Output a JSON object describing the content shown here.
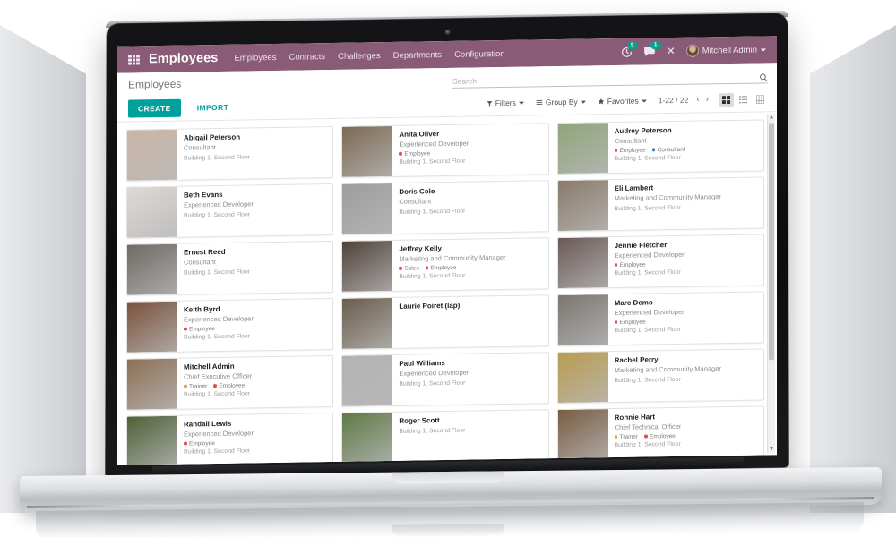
{
  "navbar": {
    "apps_icon": "apps-grid-icon",
    "brand": "Employees",
    "menu": [
      "Employees",
      "Contracts",
      "Challenges",
      "Departments",
      "Configuration"
    ],
    "activity_icon": "clock-activity-icon",
    "activity_count": "5",
    "messages_icon": "chat-bubble-icon",
    "messages_count": "1",
    "debug_icon": "bug-close-icon",
    "debug_symbol": "✕",
    "user_name": "Mitchell Admin",
    "user_avatar": "user-avatar",
    "accent_purple": "#8a5b77",
    "badge_green": "#00a58b"
  },
  "control_panel": {
    "breadcrumb": "Employees",
    "search_placeholder": "Search",
    "search_value": "",
    "search_icon": "search-icon",
    "create_label": "CREATE",
    "import_label": "IMPORT",
    "create_color": "#00a09d",
    "filters_label": "Filters",
    "filters_icon": "filter-funnel-icon",
    "groupby_label": "Group By",
    "groupby_icon": "list-lines-icon",
    "favorites_label": "Favorites",
    "favorites_icon": "star-icon",
    "pager": "1-22 / 22",
    "prev_arrow": "‹",
    "next_arrow": "›",
    "views": [
      {
        "name": "kanban-view-button",
        "icon": "kanban-grid-icon",
        "active": true
      },
      {
        "name": "list-view-button",
        "icon": "list-view-icon",
        "active": false
      },
      {
        "name": "grid-view-button",
        "icon": "table-grid-icon",
        "active": false
      }
    ]
  },
  "tag_colors": {
    "employee": "#e54c4c",
    "consultant": "#3b7bd4",
    "sales": "#e54c4c",
    "trainer": "#e9a13b"
  },
  "employees": [
    {
      "name": "Abigail Peterson",
      "job": "Consultant",
      "tags": [],
      "location": "Building 1, Second Floor",
      "photo": "#cbb6a6"
    },
    {
      "name": "Anita Oliver",
      "job": "Experienced Developer",
      "tags": [
        {
          "label": "Employee",
          "color": "#e54c4c"
        }
      ],
      "location": "Building 1, Second Floor",
      "photo": "#7c6a52"
    },
    {
      "name": "Audrey Peterson",
      "job": "Consultant",
      "tags": [
        {
          "label": "Employee",
          "color": "#e54c4c"
        },
        {
          "label": "Consultant",
          "color": "#3b7bd4"
        }
      ],
      "location": "Building 1, Second Floor",
      "photo": "#90a578"
    },
    {
      "name": "Beth Evans",
      "job": "Experienced Developer",
      "tags": [],
      "location": "Building 1, Second Floor",
      "photo": "#ded9d6"
    },
    {
      "name": "Doris Cole",
      "job": "Consultant",
      "tags": [],
      "location": "Building 1, Second Floor",
      "photo": "#9d9d9d"
    },
    {
      "name": "Eli Lambert",
      "job": "Marketing and Community Manager",
      "tags": [],
      "location": "Building 1, Second Floor",
      "photo": "#8a7b6b"
    },
    {
      "name": "Ernest Reed",
      "job": "Consultant",
      "tags": [],
      "location": "Building 1, Second Floor",
      "photo": "#6e6a64"
    },
    {
      "name": "Jeffrey Kelly",
      "job": "Marketing and Community Manager",
      "tags": [
        {
          "label": "Sales",
          "color": "#e54c4c"
        },
        {
          "label": "Employee",
          "color": "#e54c4c"
        }
      ],
      "location": "Building 1, Second Floor",
      "photo": "#50423a"
    },
    {
      "name": "Jennie Fletcher",
      "job": "Experienced Developer",
      "tags": [
        {
          "label": "Employee",
          "color": "#e54c4c"
        }
      ],
      "location": "Building 1, Second Floor",
      "photo": "#6a5a56"
    },
    {
      "name": "Keith Byrd",
      "job": "Experienced Developer",
      "tags": [
        {
          "label": "Employee",
          "color": "#e54c4c"
        }
      ],
      "location": "Building 1, Second Floor",
      "photo": "#79523a"
    },
    {
      "name": "Laurie Poiret (lap)",
      "job": "",
      "tags": [],
      "location": "",
      "photo": "#6b5d4c"
    },
    {
      "name": "Marc Demo",
      "job": "Experienced Developer",
      "tags": [
        {
          "label": "Employee",
          "color": "#e54c4c"
        }
      ],
      "location": "Building 1, Second Floor",
      "photo": "#7b7671"
    },
    {
      "name": "Mitchell Admin",
      "job": "Chief Executive Officer",
      "tags": [
        {
          "label": "Trainer",
          "color": "#e9a13b"
        },
        {
          "label": "Employee",
          "color": "#e54c4c"
        }
      ],
      "location": "Building 1, Second Floor",
      "photo": "#8e6f55"
    },
    {
      "name": "Paul Williams",
      "job": "Experienced Developer",
      "tags": [],
      "location": "Building 1, Second Floor",
      "photo": "#b3b3b3"
    },
    {
      "name": "Rachel Perry",
      "job": "Marketing and Community Manager",
      "tags": [],
      "location": "Building 1, Second Floor",
      "photo": "#b99c4e"
    },
    {
      "name": "Randall Lewis",
      "job": "Experienced Developer",
      "tags": [
        {
          "label": "Employee",
          "color": "#e54c4c"
        }
      ],
      "location": "Building 1, Second Floor",
      "photo": "#4f6138"
    },
    {
      "name": "Roger Scott",
      "job": "",
      "tags": [],
      "location": "Building 1, Second Floor",
      "photo": "#5f7a46"
    },
    {
      "name": "Ronnie Hart",
      "job": "Chief Technical Officer",
      "tags": [
        {
          "label": "Trainer",
          "color": "#e9a13b"
        },
        {
          "label": "Employee",
          "color": "#e54c4c"
        }
      ],
      "location": "Building 1, Second Floor",
      "photo": "#7a5c42"
    }
  ],
  "scrollbar": {
    "up_arrow": "▲",
    "down_arrow": "▼"
  }
}
